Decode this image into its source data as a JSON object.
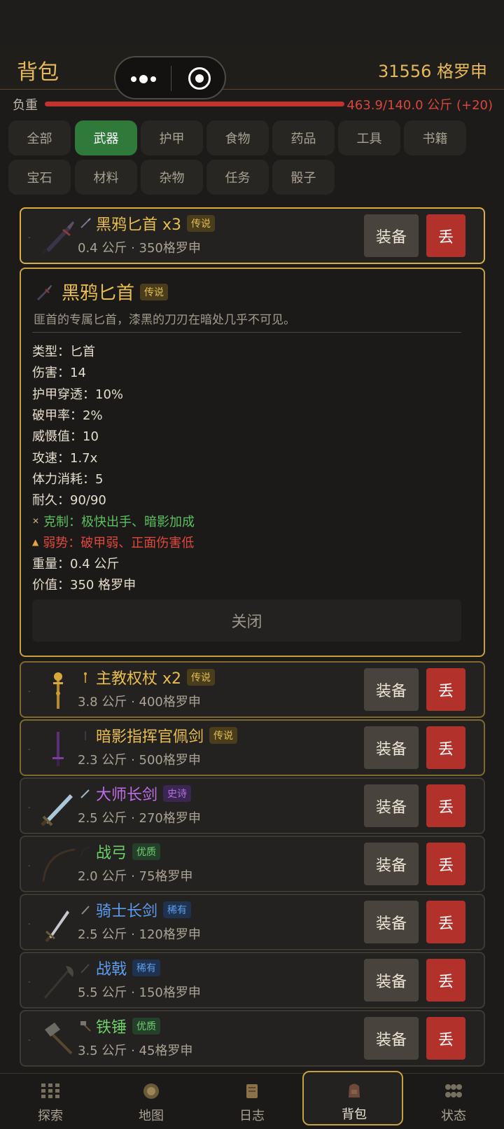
{
  "header": {
    "title": "背包",
    "gold": "31556 格罗申"
  },
  "load": {
    "label": "负重",
    "value": "463.9/140.0 公斤 (+20)",
    "fill_ratio": 1.0
  },
  "tabs": [
    {
      "label": "全部"
    },
    {
      "label": "武器"
    },
    {
      "label": "护甲"
    },
    {
      "label": "食物"
    },
    {
      "label": "药品"
    },
    {
      "label": "工具"
    },
    {
      "label": "书籍"
    },
    {
      "label": "宝石"
    },
    {
      "label": "材料"
    },
    {
      "label": "杂物"
    },
    {
      "label": "任务"
    },
    {
      "label": "骰子"
    }
  ],
  "active_tab": "武器",
  "buttons": {
    "equip": "装备",
    "drop": "丢"
  },
  "items": [
    {
      "name": "黑鸦匕首 x3",
      "badge": "传说",
      "meta": "0.4 公斤 · 350格罗申",
      "icon": "dagger-icon"
    },
    {
      "name": "主教权杖 x2",
      "badge": "传说",
      "meta": "3.8 公斤 · 400格罗申",
      "icon": "scepter-icon"
    },
    {
      "name": "暗影指挥官佩剑",
      "badge": "传说",
      "meta": "2.3 公斤 · 500格罗申",
      "icon": "shadow-sword-icon"
    },
    {
      "name": "大师长剑",
      "badge": "史诗",
      "meta": "2.5 公斤 · 270格罗申",
      "icon": "longsword-icon"
    },
    {
      "name": "战弓",
      "badge": "优质",
      "meta": "2.0 公斤 · 75格罗申",
      "icon": "bow-icon"
    },
    {
      "name": "骑士长剑",
      "badge": "稀有",
      "meta": "2.5 公斤 · 120格罗申",
      "icon": "knight-sword-icon"
    },
    {
      "name": "战戟",
      "badge": "稀有",
      "meta": "5.5 公斤 · 150格罗申",
      "icon": "halberd-icon"
    },
    {
      "name": "铁锤",
      "badge": "优质",
      "meta": "3.5 公斤 · 45格罗申",
      "icon": "hammer-icon"
    }
  ],
  "detail": {
    "name": "黑鸦匕首",
    "badge": "传说",
    "description": "匪首的专属匕首，漆黑的刀刃在暗处几乎不可见。",
    "stats": [
      "类型：匕首",
      "伤害：14",
      "护甲穿透：10%",
      "破甲率：2%",
      "威慑值：10",
      "攻速：1.7x",
      "体力消耗：5",
      "耐久：90/90"
    ],
    "counter": "克制：极快出手、暗影加成",
    "weakness": "弱势：破甲弱、正面伤害低",
    "weight": "重量：0.4 公斤",
    "value": "价值：350 格罗申",
    "close": "关闭"
  },
  "nav": [
    {
      "label": "探索",
      "icon": "explore-grid-icon"
    },
    {
      "label": "地图",
      "icon": "map-compass-icon"
    },
    {
      "label": "日志",
      "icon": "journal-scroll-icon"
    },
    {
      "label": "背包",
      "icon": "backpack-icon"
    },
    {
      "label": "状态",
      "icon": "status-icon"
    }
  ],
  "colors": {
    "legend": "#e8bd4f",
    "epic": "#c06de8",
    "good": "#6cd068",
    "rare": "#5c9cf0",
    "accent_green": "#2f7a3a",
    "drop_red": "#b3312b"
  }
}
